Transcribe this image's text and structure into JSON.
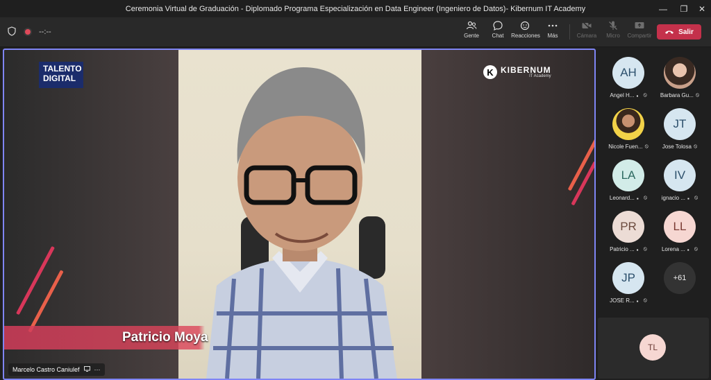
{
  "window": {
    "title": "Ceremonia Virtual de Graduación - Diplomado Programa Especialización en Data Engineer (Ingeniero de Datos)- Kibernum IT Academy"
  },
  "toolbar": {
    "timer": "--:--",
    "people_label": "Gente",
    "chat_label": "Chat",
    "reactions_label": "Reacciones",
    "more_label": "Más",
    "camera_label": "Cámara",
    "mic_label": "Micro",
    "share_label": "Compartir",
    "leave_label": "Salir"
  },
  "stage": {
    "badge_line1": "TALENTO",
    "badge_line2": "DIGITAL",
    "logo_name": "KIBERNUM",
    "logo_sub": "IT Academy",
    "speaker_lower_third": "Patricio Moya",
    "presenter_tag": "Marcelo Castro Caniulef"
  },
  "participants": [
    {
      "initials": "AH",
      "name": "Angel H...",
      "bg": "#d6e6f0",
      "fg": "#2c4f6b"
    },
    {
      "initials": "",
      "name": "Barbara Gu...",
      "bg": "#c9a08a",
      "fg": "#000000"
    },
    {
      "initials": "",
      "name": "Nicole Fuen...",
      "bg": "#e8c440",
      "fg": "#000000"
    },
    {
      "initials": "JT",
      "name": "Jose Tolosa",
      "bg": "#d6e6f0",
      "fg": "#2c4f6b"
    },
    {
      "initials": "LA",
      "name": "Leonard...",
      "bg": "#d2ece8",
      "fg": "#2d6a60"
    },
    {
      "initials": "IV",
      "name": "ignacio ...",
      "bg": "#d6e6f0",
      "fg": "#2c4f6b"
    },
    {
      "initials": "PR",
      "name": "Patricio ...",
      "bg": "#ecdcd5",
      "fg": "#6b4a3e"
    },
    {
      "initials": "LL",
      "name": "Lorena ...",
      "bg": "#f6d7d2",
      "fg": "#7a3a33"
    },
    {
      "initials": "JP",
      "name": "JOSE R...",
      "bg": "#d6e6f0",
      "fg": "#2c4f6b"
    }
  ],
  "overflow_count": "+61",
  "self_view": {
    "initials": "TL"
  }
}
